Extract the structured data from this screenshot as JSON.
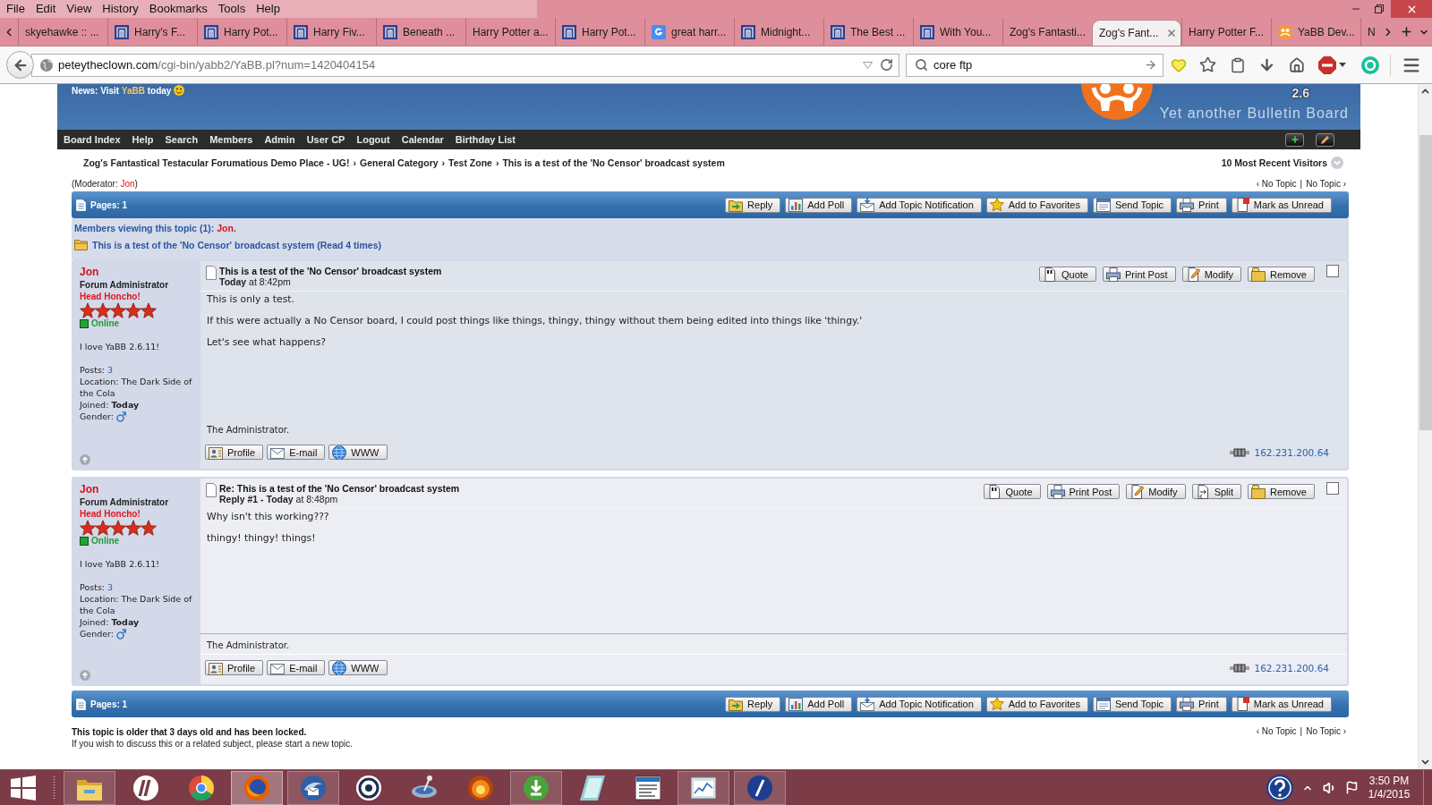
{
  "menu_bar": {
    "items": [
      "File",
      "Edit",
      "View",
      "History",
      "Bookmarks",
      "Tools",
      "Help"
    ]
  },
  "tabs": [
    {
      "label": "skyehawke :: ...",
      "kind": "plain",
      "selected": false
    },
    {
      "label": "Harry's F...",
      "kind": "site",
      "selected": false
    },
    {
      "label": "Harry Pot...",
      "kind": "site",
      "selected": false
    },
    {
      "label": "Harry Fiv...",
      "kind": "site",
      "selected": false
    },
    {
      "label": "Beneath ...",
      "kind": "site",
      "selected": false
    },
    {
      "label": "Harry Potter a...",
      "kind": "plain",
      "selected": false
    },
    {
      "label": "Harry Pot...",
      "kind": "site",
      "selected": false
    },
    {
      "label": "great harr...",
      "kind": "google",
      "selected": false
    },
    {
      "label": "Midnight...",
      "kind": "site",
      "selected": false
    },
    {
      "label": "The Best ...",
      "kind": "site",
      "selected": false
    },
    {
      "label": "With You...",
      "kind": "site",
      "selected": false
    },
    {
      "label": "Zog's Fantasti...",
      "kind": "plain",
      "selected": false
    },
    {
      "label": "Zog's Fant...",
      "kind": "plain",
      "selected": true
    },
    {
      "label": "Harry Potter F...",
      "kind": "plain",
      "selected": false
    },
    {
      "label": "YaBB Dev...",
      "kind": "yabb",
      "selected": false
    },
    {
      "label": "N",
      "kind": "plain",
      "selected": false
    }
  ],
  "address_bar": {
    "domain": "peteytheclown.com",
    "path": "/cgi-bin/yabb2/YaBB.pl?num=1420404154"
  },
  "search_bar": {
    "value": "core ftp"
  },
  "forum": {
    "news": {
      "before": "News: Visit",
      "link": "YaBB",
      "after": "today"
    },
    "logo": {
      "version": "2.6",
      "tagline": "Yet another Bulletin Board"
    },
    "nav": [
      "Board Index",
      "Help",
      "Search",
      "Members",
      "Admin",
      "User CP",
      "Logout",
      "Calendar",
      "Birthday List"
    ],
    "breadcrumb": [
      {
        "label": "Zog's Fantastical Testacular Forumatious Demo Place - UG!",
        "separator": "›"
      },
      {
        "label": "General Category",
        "separator": "›"
      },
      {
        "label": "Test Zone",
        "separator": "›"
      },
      {
        "label": "This is a test of the 'No Censor' broadcast system"
      }
    ],
    "recent_visitors": "10 Most Recent Visitors",
    "moderator": {
      "label": "(Moderator:",
      "name": "Jon",
      "close": ")"
    },
    "topic_nav_top": {
      "prev": "‹ No Topic",
      "separator": "|",
      "next": "No Topic ›"
    },
    "toolbar_top": {
      "pages": "Pages: 1",
      "buttons": [
        {
          "label": "Reply",
          "kind": "reply"
        },
        {
          "label": "Add Poll",
          "kind": "add-poll"
        },
        {
          "label": "Add Topic Notification",
          "kind": "notification"
        },
        {
          "label": "Add to Favorites",
          "kind": "favorites"
        },
        {
          "label": "Send Topic",
          "kind": "send-topic"
        },
        {
          "label": "Print",
          "kind": "print"
        },
        {
          "label": "Mark as Unread",
          "kind": "mark-unread"
        }
      ]
    },
    "viewers": {
      "label": "Members viewing this topic (1):",
      "name": "Jon",
      "end": "."
    },
    "topic_title": "This is a test of the 'No Censor' broadcast system (Read 4 times)",
    "posts": [
      {
        "author": "Jon",
        "role": "Forum Administrator",
        "rank": "Head Honcho!",
        "stars": 5,
        "online": true,
        "status": "Online",
        "personal_text": "I love YaBB 2.6.11!",
        "posts_label": "Posts:",
        "post_count": "3",
        "location": "Location: The Dark Side of the Cola",
        "joined": "Joined: **Today**",
        "gender_label": "Gender:",
        "subject": "This is a test of the 'No Censor' broadcast system",
        "date": "**Today** at 8:42pm",
        "actions": [
          {
            "label": "Quote",
            "kind": "quote"
          },
          {
            "label": "Print Post",
            "kind": "print-post"
          },
          {
            "label": "Modify",
            "kind": "modify"
          },
          {
            "label": "Remove",
            "kind": "remove"
          }
        ],
        "checked": false,
        "body": [
          "This is only a test.",
          "If this were actually a No Censor board, I could post things like things, thingy, thingy without them being edited into things like 'thingy.'",
          "Let's see what happens?"
        ],
        "signature": "The Administrator.",
        "contact": [
          {
            "label": "Profile",
            "kind": "profile"
          },
          {
            "label": "E-mail",
            "kind": "email"
          },
          {
            "label": "WWW",
            "kind": "website"
          }
        ],
        "ip": "162.231.200.64"
      },
      {
        "author": "Jon",
        "role": "Forum Administrator",
        "rank": "Head Honcho!",
        "stars": 5,
        "online": true,
        "status": "Online",
        "personal_text": "I love YaBB 2.6.11!",
        "posts_label": "Posts:",
        "post_count": "3",
        "location": "Location: The Dark Side of the Cola",
        "joined": "Joined: **Today**",
        "gender_label": "Gender:",
        "subject": "Re: This is a test of the 'No Censor' broadcast system",
        "date": "**Reply #1 - Today** at 8:48pm",
        "actions": [
          {
            "label": "Quote",
            "kind": "quote"
          },
          {
            "label": "Print Post",
            "kind": "print-post"
          },
          {
            "label": "Modify",
            "kind": "modify"
          },
          {
            "label": "Split",
            "kind": "split"
          },
          {
            "label": "Remove",
            "kind": "remove"
          }
        ],
        "checked": false,
        "body": [
          "Why isn't this working???",
          "thingy! thingy! things!"
        ],
        "signature": "The Administrator.",
        "contact": [
          {
            "label": "Profile",
            "kind": "profile"
          },
          {
            "label": "E-mail",
            "kind": "email"
          },
          {
            "label": "WWW",
            "kind": "website"
          }
        ],
        "ip": "162.231.200.64"
      }
    ],
    "toolbar_bottom": {
      "pages": "Pages: 1",
      "buttons": [
        {
          "label": "Reply",
          "kind": "reply"
        },
        {
          "label": "Add Poll",
          "kind": "add-poll"
        },
        {
          "label": "Add Topic Notification",
          "kind": "notification"
        },
        {
          "label": "Add to Favorites",
          "kind": "favorites"
        },
        {
          "label": "Send Topic",
          "kind": "send-topic"
        },
        {
          "label": "Print",
          "kind": "print"
        },
        {
          "label": "Mark as Unread",
          "kind": "mark-unread"
        }
      ]
    },
    "locked": {
      "notice": "This topic is older that 3 days old and has been locked.",
      "hint": "If you wish to discuss this or a related subject, please start a new topic."
    },
    "topic_nav_bottom": {
      "prev": "‹ No Topic",
      "separator": "|",
      "next": "No Topic ›"
    }
  },
  "taskbar": {
    "apps": [
      {
        "kind": "folder",
        "open": true,
        "selected": false
      },
      {
        "kind": "round-logo",
        "open": false,
        "selected": false
      },
      {
        "kind": "color-wheel",
        "open": false,
        "selected": false
      },
      {
        "kind": "fox",
        "open": true,
        "selected": true
      },
      {
        "kind": "mail",
        "open": true,
        "selected": false
      },
      {
        "kind": "ring",
        "open": false,
        "selected": false
      },
      {
        "kind": "satellite",
        "open": false,
        "selected": false
      },
      {
        "kind": "fire",
        "open": false,
        "selected": false
      },
      {
        "kind": "torrent",
        "open": true,
        "selected": false
      },
      {
        "kind": "notepad",
        "open": false,
        "selected": false
      },
      {
        "kind": "window",
        "open": false,
        "selected": false
      },
      {
        "kind": "chart",
        "open": true,
        "selected": false
      },
      {
        "kind": "slash",
        "open": true,
        "selected": false
      }
    ],
    "time": "3:50 PM",
    "date": "1/4/2015"
  }
}
